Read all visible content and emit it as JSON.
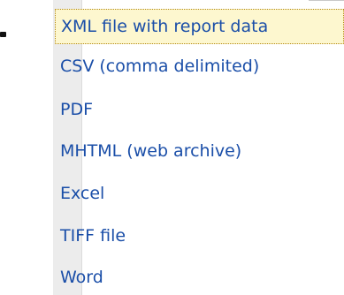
{
  "menu": {
    "items": [
      {
        "label": "XML file with report data",
        "selected": true
      },
      {
        "label": "CSV (comma delimited)",
        "selected": false
      },
      {
        "label": "PDF",
        "selected": false
      },
      {
        "label": "MHTML (web archive)",
        "selected": false
      },
      {
        "label": "Excel",
        "selected": false
      },
      {
        "label": "TIFF file",
        "selected": false
      },
      {
        "label": "Word",
        "selected": false
      }
    ]
  },
  "colors": {
    "item_text": "#1a4ea8",
    "selected_background": "#fdf7cf",
    "selected_border": "#b58b16",
    "gutter": "#ececec"
  }
}
